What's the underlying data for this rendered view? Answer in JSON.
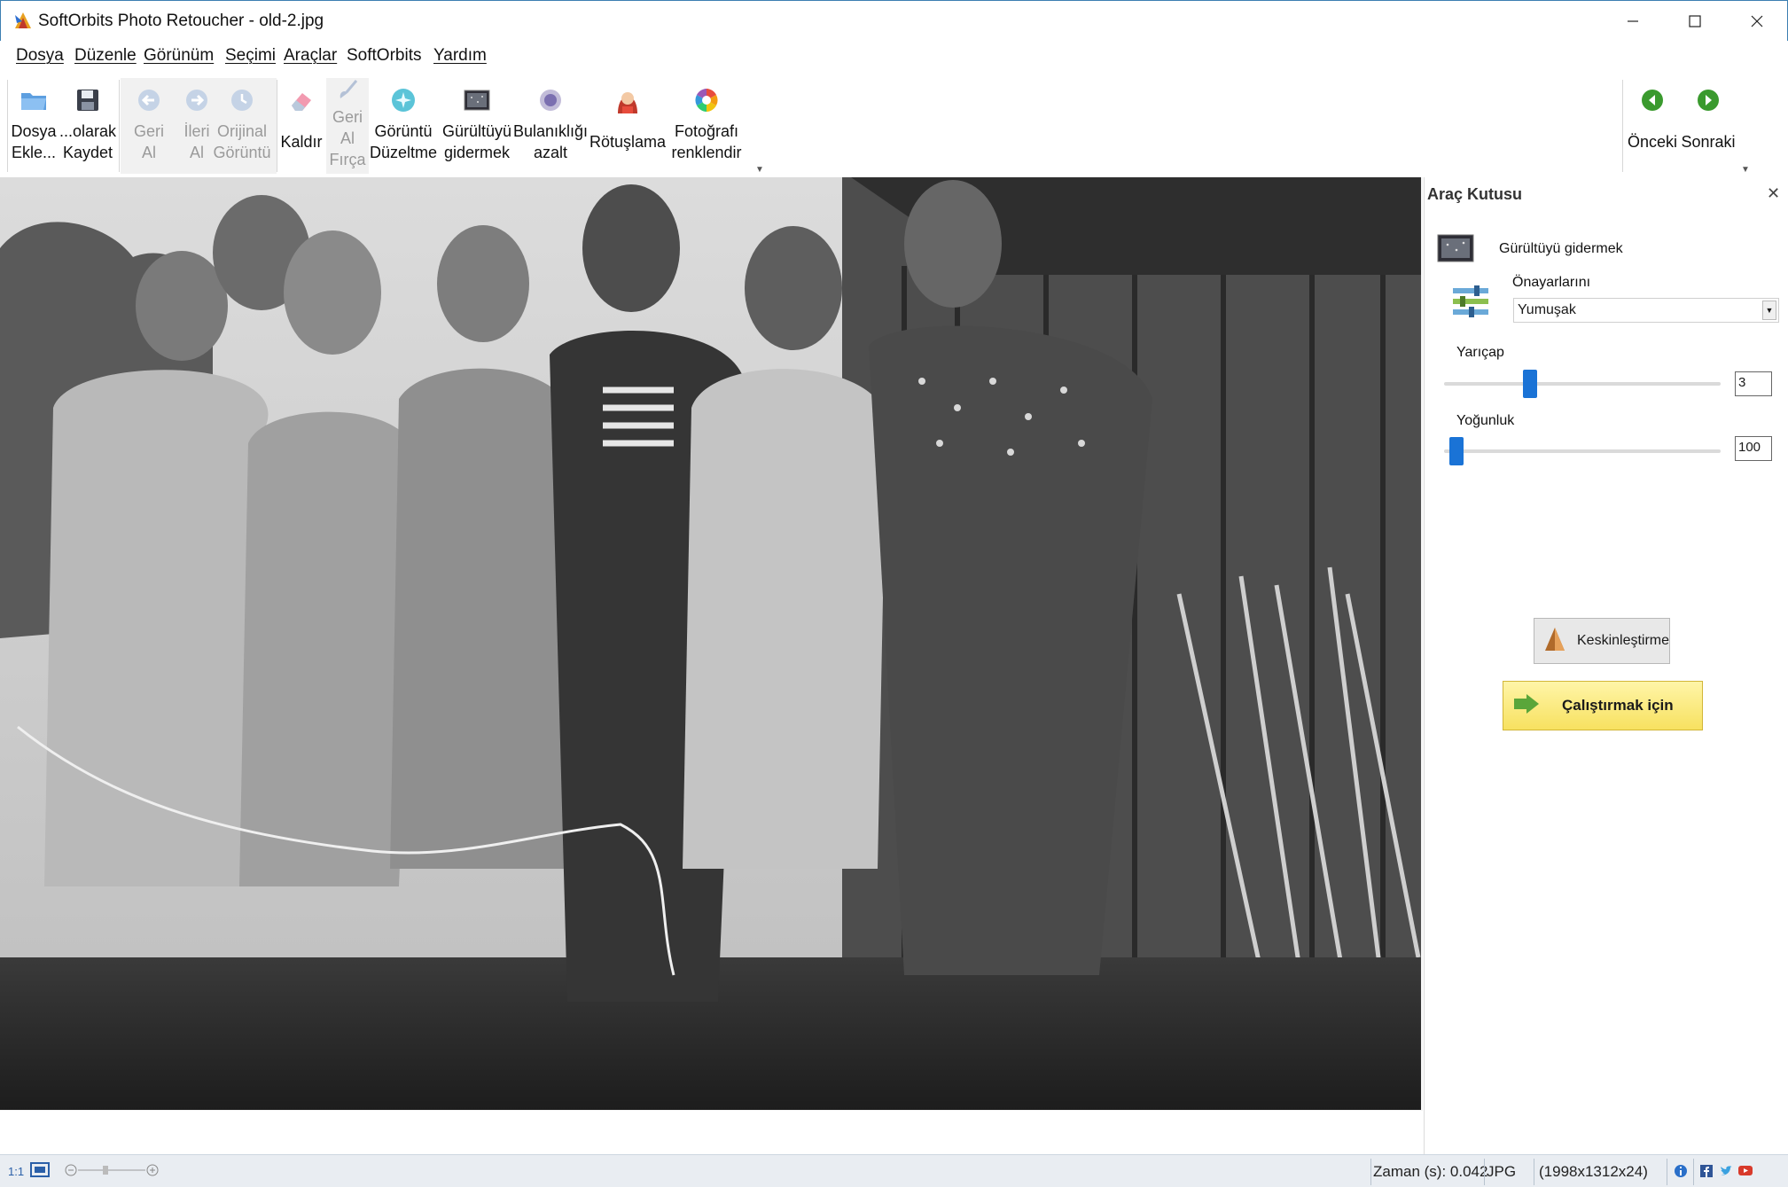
{
  "window": {
    "title": "SoftOrbits Photo Retoucher - old-2.jpg"
  },
  "menu": [
    "Dosya",
    "Düzenle",
    "Görünüm",
    "Seçimi",
    "Araçlar",
    "SoftOrbits",
    "Yardım"
  ],
  "ribbon": {
    "add_file": [
      "Dosya",
      "Ekle..."
    ],
    "save_as": [
      "...olarak",
      "Kaydet"
    ],
    "undo": [
      "Geri",
      "Al"
    ],
    "redo": [
      "İleri",
      "Al"
    ],
    "original": [
      "Orijinal",
      "Görüntü"
    ],
    "remove": [
      "Kaldır"
    ],
    "undo_brush": [
      "Geri",
      "Al",
      "Fırça"
    ],
    "image_fix": [
      "Görüntü",
      "Düzeltme"
    ],
    "denoise": [
      "Gürültüyü",
      "gidermek"
    ],
    "deblur": [
      "Bulanıklığı",
      "azalt"
    ],
    "retouch": [
      "Rötuşlama"
    ],
    "colorize": [
      "Fotoğrafı",
      "renklendir"
    ],
    "prev": [
      "Önceki"
    ],
    "next": [
      "Sonraki"
    ]
  },
  "toolbox": {
    "title": "Araç Kutusu",
    "tool_name": "Gürültüyü gidermek",
    "presets_label": "Önayarlarını",
    "preset_value": "Yumuşak",
    "radius_label": "Yarıçap",
    "radius_value": "3",
    "radius_fraction": 0.3,
    "density_label": "Yoğunluk",
    "density_value": "100",
    "density_fraction": 0.02,
    "sharpen_button": "Keskinleştirme",
    "run_button": "Çalıştırmak için"
  },
  "status": {
    "zoom_1to1": "1:1",
    "time": "Zaman (s): 0.042",
    "format": "JPG",
    "dimensions": "(1998x1312x24)"
  },
  "colors": {
    "accent": "#1a73d6",
    "run_button": "#f7e160",
    "statusbar": "#e9edf2"
  }
}
